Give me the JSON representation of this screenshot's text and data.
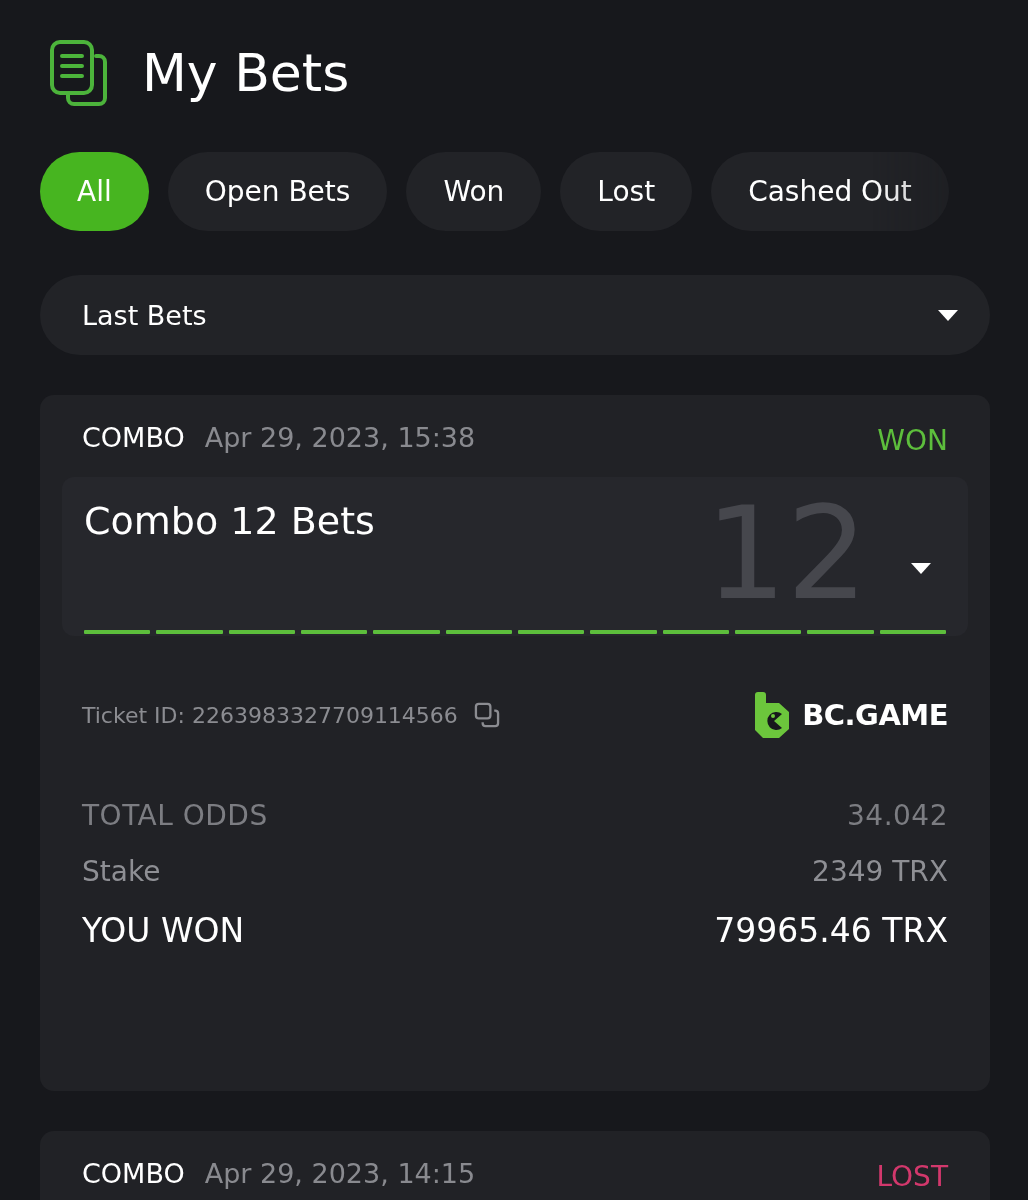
{
  "header": {
    "title": "My Bets"
  },
  "tabs": [
    {
      "label": "All",
      "selected": true
    },
    {
      "label": "Open Bets",
      "selected": false
    },
    {
      "label": "Won",
      "selected": false
    },
    {
      "label": "Lost",
      "selected": false
    },
    {
      "label": "Cashed Out",
      "selected": false
    }
  ],
  "filter": {
    "value": "Last Bets"
  },
  "bets": [
    {
      "bet_type": "COMBO",
      "date": "Apr 29, 2023, 15:38",
      "status": "WON",
      "color": "#5dbe3c",
      "title": "Combo 12 Bets",
      "background_number": "12",
      "legs": [
        {
          "won": true
        },
        {
          "won": true
        },
        {
          "won": true
        },
        {
          "won": true
        },
        {
          "won": true
        },
        {
          "won": true
        },
        {
          "won": true
        },
        {
          "won": true
        },
        {
          "won": true
        },
        {
          "won": true
        },
        {
          "won": true
        },
        {
          "won": true
        }
      ],
      "ticket": "Ticket ID: 2263983327709114566",
      "brand": "BC.GAME",
      "rows": [
        {
          "kind": "odds",
          "label": "TOTAL ODDS",
          "value": "34.042"
        },
        {
          "kind": "stake",
          "label": "Stake",
          "value": "2349 TRX"
        },
        {
          "kind": "payout",
          "label": "YOU WON",
          "value": "79965.46 TRX"
        }
      ]
    },
    {
      "bet_type": "COMBO",
      "date": "Apr 29, 2023, 14:15",
      "status": "LOST",
      "color": "#d2386c"
    }
  ]
}
